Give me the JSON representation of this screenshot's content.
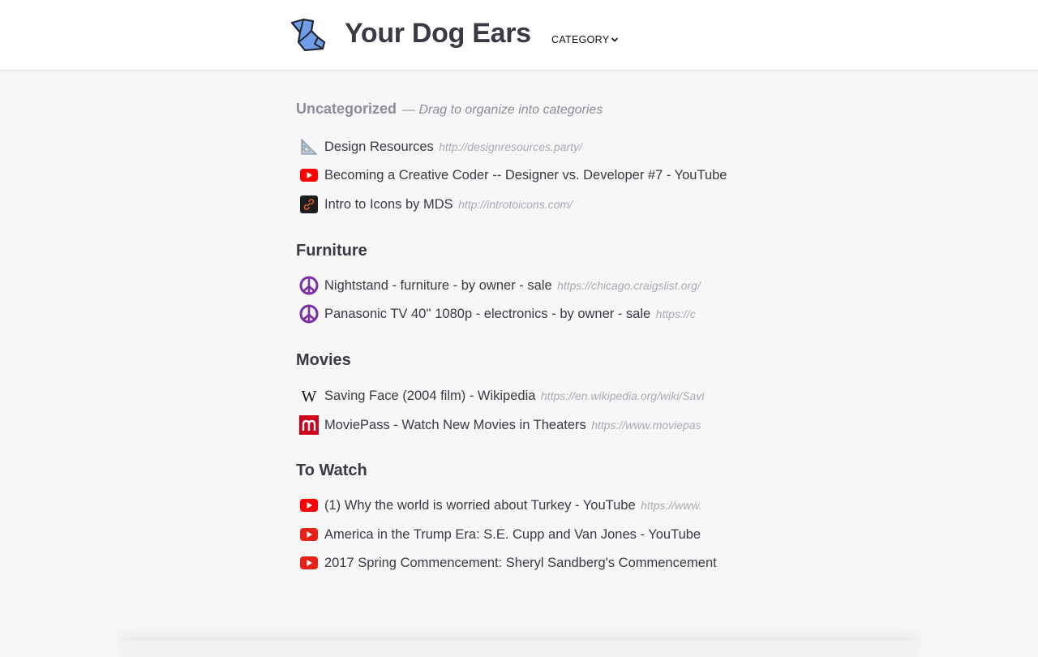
{
  "header": {
    "app_title": "Your Dog Ears",
    "category_menu_label": "CATEGORY",
    "logo_icon": "dog-ear-logo-icon"
  },
  "sections": [
    {
      "heading": "Uncategorized",
      "hint": "— Drag to organize into categories",
      "links": [
        {
          "title": "Design Resources",
          "url": "http://designresources.party/",
          "icon": "set-square-icon"
        },
        {
          "title": "Becoming a Creative Coder -- Designer vs. Developer #7 - YouTube",
          "url": "",
          "icon": "youtube-icon"
        },
        {
          "title": "Intro to Icons by MDS",
          "url": "http://introtoicons.com/",
          "icon": "link-icon"
        }
      ]
    },
    {
      "heading": "Furniture",
      "hint": "",
      "links": [
        {
          "title": "Nightstand - furniture - by owner - sale",
          "url": "https://chicago.craigslist.org/",
          "icon": "peace-sign-icon"
        },
        {
          "title": "Panasonic TV 40'' 1080p - electronics - by owner - sale",
          "url": "https://c",
          "icon": "peace-sign-icon"
        }
      ]
    },
    {
      "heading": "Movies",
      "hint": "",
      "links": [
        {
          "title": "Saving Face (2004 film) - Wikipedia",
          "url": "https://en.wikipedia.org/wiki/Savi",
          "icon": "wikipedia-icon"
        },
        {
          "title": "MoviePass - Watch New Movies in Theaters",
          "url": "https://www.moviepas",
          "icon": "moviepass-icon"
        }
      ]
    },
    {
      "heading": "To Watch",
      "hint": "",
      "links": [
        {
          "title": "(1) Why the world is worried about Turkey - YouTube",
          "url": "https://www.",
          "icon": "youtube-icon"
        },
        {
          "title": "America in the Trump Era: S.E. Cupp and Van Jones - YouTube",
          "url": "",
          "icon": "youtube-icon"
        },
        {
          "title": "2017 Spring Commencement: Sheryl Sandberg's Commencement",
          "url": "",
          "icon": "youtube-icon"
        }
      ]
    }
  ],
  "colors": {
    "heading": "#393a43",
    "muted": "#8a8c99",
    "url": "#a8aab5",
    "youtube_red": "#ff0000",
    "moviepass_red": "#d0021b",
    "peace_purple": "#7b2fa6",
    "logo_blue": "#6f9ee6"
  }
}
